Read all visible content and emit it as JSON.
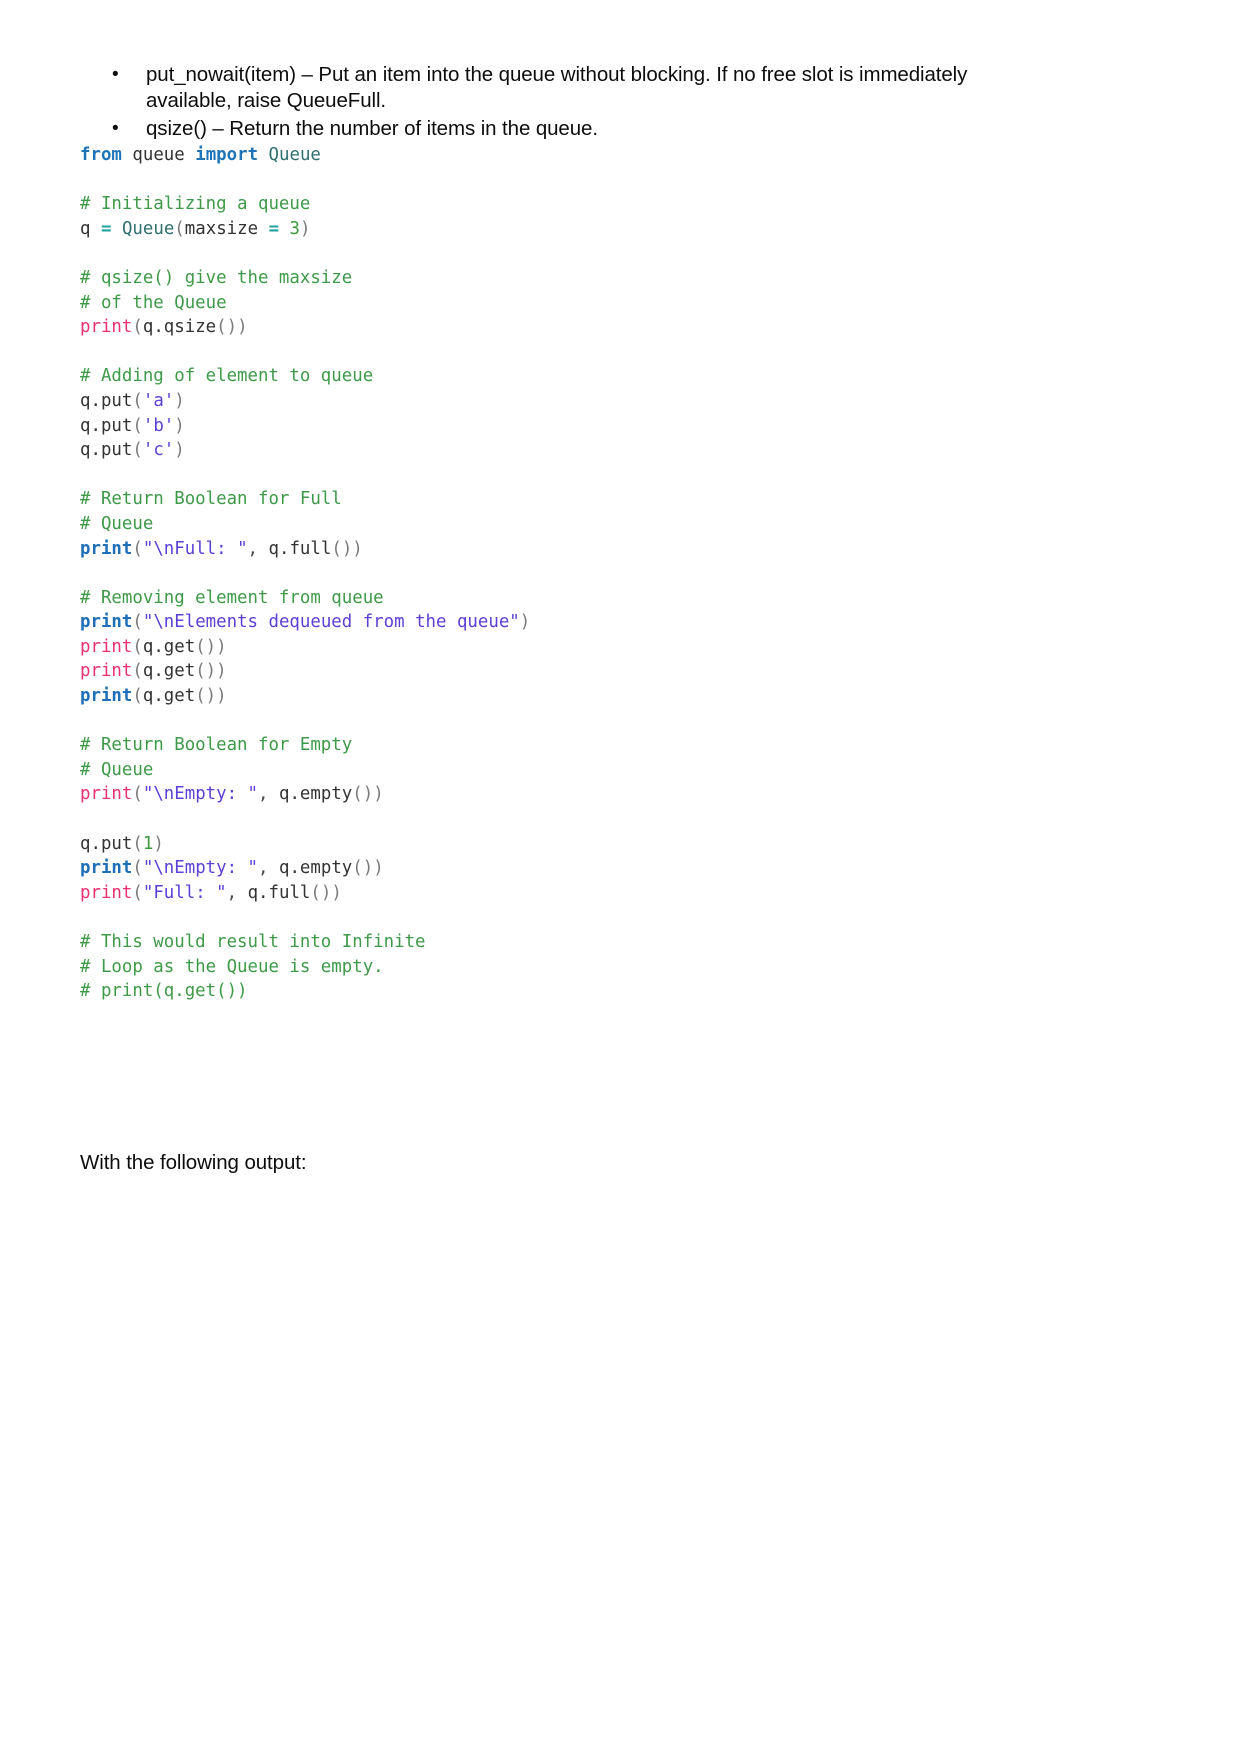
{
  "document": {
    "bullets": [
      {
        "marker": "•",
        "text": "put_nowait(item) – Put an item into the queue without blocking. If no free slot is immediately available, raise QueueFull."
      },
      {
        "marker": "•",
        "text": "qsize() – Return the number of items in the queue."
      }
    ],
    "closing_text": "With the following output:"
  },
  "code_block": {
    "language": "python",
    "full_text": "from queue import Queue\n\n# Initializing a queue\nq = Queue(maxsize = 3)\n\n# qsize() give the maxsize\n# of the Queue\nprint(q.qsize())\n\n# Adding of element to queue\nq.put('a')\nq.put('b')\nq.put('c')\n\n# Return Boolean for Full\n# Queue\nprint(\"\\nFull: \", q.full())\n\n# Removing element from queue\nprint(\"\\nElements dequeued from the queue\")\nprint(q.get())\nprint(q.get())\nprint(q.get())\n\n# Return Boolean for Empty\n# Queue\nprint(\"\\nEmpty: \", q.empty())\n\nq.put(1)\nprint(\"\\nEmpty: \", q.empty())\nprint(\"Full: \", q.full())\n\n# This would result into Infinite\n# Loop as the Queue is empty.\n# print(q.get())",
    "lines": [
      {
        "id": "l1",
        "type": "code",
        "text": "from queue import Queue"
      },
      {
        "id": "l2",
        "type": "blank",
        "text": ""
      },
      {
        "id": "l3",
        "type": "comment",
        "text": "# Initializing a queue"
      },
      {
        "id": "l4",
        "type": "code",
        "text": "q = Queue(maxsize = 3)"
      },
      {
        "id": "l5",
        "type": "blank",
        "text": ""
      },
      {
        "id": "l6",
        "type": "comment",
        "text": "# qsize() give the maxsize"
      },
      {
        "id": "l7",
        "type": "comment",
        "text": "# of the Queue"
      },
      {
        "id": "l8",
        "type": "code",
        "text": "print(q.qsize())"
      },
      {
        "id": "l9",
        "type": "blank",
        "text": ""
      },
      {
        "id": "l10",
        "type": "comment",
        "text": "# Adding of element to queue"
      },
      {
        "id": "l11",
        "type": "code",
        "text": "q.put('a')"
      },
      {
        "id": "l12",
        "type": "code",
        "text": "q.put('b')"
      },
      {
        "id": "l13",
        "type": "code",
        "text": "q.put('c')"
      },
      {
        "id": "l14",
        "type": "blank",
        "text": ""
      },
      {
        "id": "l15",
        "type": "comment",
        "text": "# Return Boolean for Full"
      },
      {
        "id": "l16",
        "type": "comment",
        "text": "# Queue"
      },
      {
        "id": "l17",
        "type": "code",
        "text": "print(\"\\nFull: \", q.full())"
      },
      {
        "id": "l18",
        "type": "blank",
        "text": ""
      },
      {
        "id": "l19",
        "type": "comment",
        "text": "# Removing element from queue"
      },
      {
        "id": "l20",
        "type": "code",
        "text": "print(\"\\nElements dequeued from the queue\")"
      },
      {
        "id": "l21",
        "type": "code",
        "text": "print(q.get())"
      },
      {
        "id": "l22",
        "type": "code",
        "text": "print(q.get())"
      },
      {
        "id": "l23",
        "type": "code",
        "text": "print(q.get())"
      },
      {
        "id": "l24",
        "type": "blank",
        "text": ""
      },
      {
        "id": "l25",
        "type": "comment",
        "text": "# Return Boolean for Empty"
      },
      {
        "id": "l26",
        "type": "comment",
        "text": "# Queue"
      },
      {
        "id": "l27",
        "type": "code",
        "text": "print(\"\\nEmpty: \", q.empty())"
      },
      {
        "id": "l28",
        "type": "blank",
        "text": ""
      },
      {
        "id": "l29",
        "type": "code",
        "text": "q.put(1)"
      },
      {
        "id": "l30",
        "type": "code",
        "text": "print(\"\\nEmpty: \", q.empty())"
      },
      {
        "id": "l31",
        "type": "code",
        "text": "print(\"Full: \", q.full())"
      },
      {
        "id": "l32",
        "type": "blank",
        "text": ""
      },
      {
        "id": "l33",
        "type": "comment",
        "text": "# This would result into Infinite"
      },
      {
        "id": "l34",
        "type": "comment",
        "text": "# Loop as the Queue is empty."
      },
      {
        "id": "l35",
        "type": "comment",
        "text": "# print(q.get())"
      }
    ],
    "tokens": {
      "l1": [
        [
          "from",
          "kw"
        ],
        [
          " ",
          "plain"
        ],
        [
          "queue",
          "plain"
        ],
        [
          " ",
          "plain"
        ],
        [
          "import",
          "kw"
        ],
        [
          " ",
          "plain"
        ],
        [
          "Queue",
          "name"
        ]
      ],
      "l3": [
        [
          "# Initializing a queue",
          "com"
        ]
      ],
      "l4": [
        [
          "q",
          "plain"
        ],
        [
          " ",
          "plain"
        ],
        [
          "=",
          "op"
        ],
        [
          " ",
          "plain"
        ],
        [
          "Queue",
          "name"
        ],
        [
          "(",
          "paren"
        ],
        [
          "maxsize",
          "plain"
        ],
        [
          " ",
          "plain"
        ],
        [
          "=",
          "op"
        ],
        [
          " ",
          "plain"
        ],
        [
          "3",
          "num"
        ],
        [
          ")",
          "paren"
        ]
      ],
      "l6": [
        [
          "# qsize() give the maxsize",
          "com"
        ]
      ],
      "l7": [
        [
          "# of the Queue",
          "com"
        ]
      ],
      "l8": [
        [
          "print",
          "fn-pink"
        ],
        [
          "(",
          "paren"
        ],
        [
          "q.qsize",
          "plain"
        ],
        [
          "()",
          "paren"
        ],
        [
          ")",
          "paren"
        ]
      ],
      "l10": [
        [
          "# Adding of element to queue",
          "com"
        ]
      ],
      "l11": [
        [
          "q.put",
          "plain"
        ],
        [
          "(",
          "paren"
        ],
        [
          "'a'",
          "str"
        ],
        [
          ")",
          "paren"
        ]
      ],
      "l12": [
        [
          "q.put",
          "plain"
        ],
        [
          "(",
          "paren"
        ],
        [
          "'b'",
          "str"
        ],
        [
          ")",
          "paren"
        ]
      ],
      "l13": [
        [
          "q.put",
          "plain"
        ],
        [
          "(",
          "paren"
        ],
        [
          "'c'",
          "str"
        ],
        [
          ")",
          "paren"
        ]
      ],
      "l15": [
        [
          "# Return Boolean for Full",
          "com"
        ]
      ],
      "l16": [
        [
          "# Queue",
          "com"
        ]
      ],
      "l17": [
        [
          "print",
          "fn-blue"
        ],
        [
          "(",
          "paren"
        ],
        [
          "\"\\nFull: \"",
          "str"
        ],
        [
          ",",
          "punc"
        ],
        [
          " ",
          "plain"
        ],
        [
          "q.full",
          "plain"
        ],
        [
          "()",
          "paren"
        ],
        [
          ")",
          "paren"
        ]
      ],
      "l19": [
        [
          "# Removing element from queue",
          "com"
        ]
      ],
      "l20": [
        [
          "print",
          "fn-blue"
        ],
        [
          "(",
          "paren"
        ],
        [
          "\"\\nElements dequeued from the queue\"",
          "str"
        ],
        [
          ")",
          "paren"
        ]
      ],
      "l21": [
        [
          "print",
          "fn-pink"
        ],
        [
          "(",
          "paren"
        ],
        [
          "q.get",
          "plain"
        ],
        [
          "()",
          "paren"
        ],
        [
          ")",
          "paren"
        ]
      ],
      "l22": [
        [
          "print",
          "fn-pink"
        ],
        [
          "(",
          "paren"
        ],
        [
          "q.get",
          "plain"
        ],
        [
          "()",
          "paren"
        ],
        [
          ")",
          "paren"
        ]
      ],
      "l23": [
        [
          "print",
          "fn-blue"
        ],
        [
          "(",
          "paren"
        ],
        [
          "q.get",
          "plain"
        ],
        [
          "()",
          "paren"
        ],
        [
          ")",
          "paren"
        ]
      ],
      "l25": [
        [
          "# Return Boolean for Empty",
          "com"
        ]
      ],
      "l26": [
        [
          "# Queue",
          "com"
        ]
      ],
      "l27": [
        [
          "print",
          "fn-pink"
        ],
        [
          "(",
          "paren"
        ],
        [
          "\"\\nEmpty: \"",
          "str"
        ],
        [
          ",",
          "punc"
        ],
        [
          " ",
          "plain"
        ],
        [
          "q.empty",
          "plain"
        ],
        [
          "()",
          "paren"
        ],
        [
          ")",
          "paren"
        ]
      ],
      "l29": [
        [
          "q.put",
          "plain"
        ],
        [
          "(",
          "paren"
        ],
        [
          "1",
          "num"
        ],
        [
          ")",
          "paren"
        ]
      ],
      "l30": [
        [
          "print",
          "fn-blue"
        ],
        [
          "(",
          "paren"
        ],
        [
          "\"\\nEmpty: \"",
          "str"
        ],
        [
          ",",
          "punc"
        ],
        [
          " ",
          "plain"
        ],
        [
          "q.empty",
          "plain"
        ],
        [
          "()",
          "paren"
        ],
        [
          ")",
          "paren"
        ]
      ],
      "l31": [
        [
          "print",
          "fn-pink"
        ],
        [
          "(",
          "paren"
        ],
        [
          "\"Full: \"",
          "str"
        ],
        [
          ",",
          "punc"
        ],
        [
          " ",
          "plain"
        ],
        [
          "q.full",
          "plain"
        ],
        [
          "()",
          "paren"
        ],
        [
          ")",
          "paren"
        ]
      ],
      "l33": [
        [
          "# This would result into Infinite",
          "com"
        ]
      ],
      "l34": [
        [
          "# Loop as the Queue is empty.",
          "com"
        ]
      ],
      "l35": [
        [
          "# print(q.get())",
          "com"
        ]
      ]
    }
  },
  "colors": {
    "keyword": "#1e74b8",
    "comment": "#3e9a49",
    "string": "#5b3fd6",
    "number": "#3c9a3c",
    "function_pink": "#e8316f",
    "function_blue": "#1e6fb8",
    "operator": "#1fa3a3",
    "background": "#ffffff",
    "body_text": "#0d0d0d"
  }
}
